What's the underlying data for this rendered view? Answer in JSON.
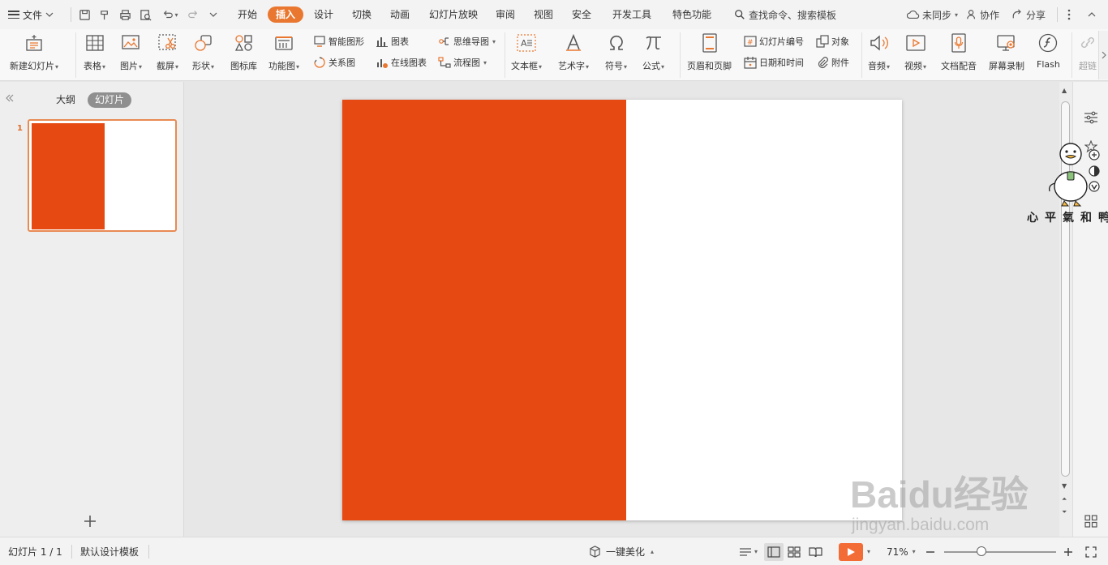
{
  "menubar": {
    "file_label": "文件",
    "tabs": [
      "开始",
      "插入",
      "设计",
      "切换",
      "动画",
      "幻灯片放映",
      "审阅",
      "视图",
      "安全",
      "开发工具",
      "特色功能"
    ],
    "active_tab": "插入",
    "search_label": "查找命令、搜索模板",
    "sync_label": "未同步",
    "collab_label": "协作",
    "share_label": "分享"
  },
  "ribbon": {
    "new_slide": "新建幻灯片",
    "table": "表格",
    "picture": "图片",
    "screenshot": "截屏",
    "shape": "形状",
    "icon_lib": "图标库",
    "function_chart": "功能图",
    "smart_shape": "智能图形",
    "chart": "图表",
    "relation_chart": "关系图",
    "online_chart": "在线图表",
    "mind_map": "思维导图",
    "flow_chart": "流程图",
    "text_box": "文本框",
    "art_text": "艺术字",
    "symbol": "符号",
    "formula": "公式",
    "header_footer": "页眉和页脚",
    "slide_number": "幻灯片编号",
    "object": "对象",
    "date_time": "日期和时间",
    "attachment": "附件",
    "audio": "音频",
    "video": "视频",
    "doc_dub": "文档配音",
    "screen_record": "屏幕录制",
    "flash": "Flash",
    "hyperlink": "超链"
  },
  "leftpanel": {
    "outline_tab": "大纲",
    "slides_tab": "幻灯片",
    "slide_number": "1"
  },
  "sticker": {
    "text": "心平氣和鸭"
  },
  "statusbar": {
    "slide_info": "幻灯片 1 / 1",
    "template": "默认设计模板",
    "beautify": "一键美化",
    "zoom": "71%"
  },
  "watermark": {
    "brand": "Baidu经验",
    "url": "jingyan.baidu.com"
  },
  "colors": {
    "accent": "#e9772f",
    "slide_red": "#e64a12",
    "play": "#f36b35"
  }
}
